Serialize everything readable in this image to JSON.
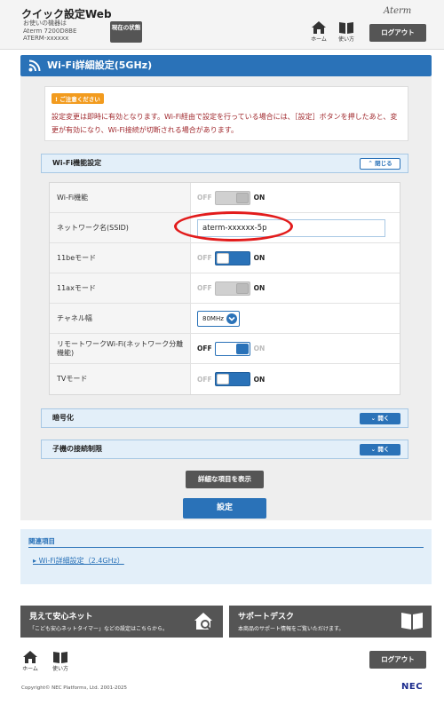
{
  "header": {
    "app_title": "クイック設定Web",
    "device_label": "お使いの機器は",
    "device_model": "Aterm 7200D8BE",
    "device_id": "ATERM-xxxxxx",
    "status_button": "現在の状態",
    "home_label": "ホーム",
    "howto_label": "使い方",
    "logout_label": "ログアウト",
    "brand_logo": "Aterm"
  },
  "page": {
    "title": "Wi-Fi詳細設定(5GHz)"
  },
  "notice": {
    "badge": "ご注意ください",
    "text": "設定変更は即時に有効となります。Wi-Fi経由で設定を行っている場合には、［設定］ボタンを押したあと、変更が有効になり、Wi-Fi接続が切断される場合があります。"
  },
  "wifi_section": {
    "title": "Wi-Fi機能設定",
    "collapse_label": "閉じる",
    "off_label": "OFF",
    "on_label": "ON",
    "rows": [
      {
        "label": "Wi-Fi機能",
        "state": "on-disabled"
      },
      {
        "label": "ネットワーク名(SSID)",
        "value": "aterm-xxxxxx-5p"
      },
      {
        "label": "11beモード",
        "state": "on"
      },
      {
        "label": "11axモード",
        "state": "on-disabled"
      },
      {
        "label": "チャネル幅",
        "value": "80MHz"
      },
      {
        "label": "リモートワークWi-Fi(ネットワーク分離機能)",
        "state": "off"
      },
      {
        "label": "TVモード",
        "state": "on"
      }
    ]
  },
  "encryption_section": {
    "title": "暗号化",
    "expand_label": "開く"
  },
  "restriction_section": {
    "title": "子機の接続制限",
    "expand_label": "開く"
  },
  "buttons": {
    "show_details": "詳細な項目を表示",
    "apply": "設定"
  },
  "related": {
    "title": "関連項目",
    "link": "Wi-Fi詳細設定（2.4GHz）"
  },
  "banners": [
    {
      "title": "見えて安心ネット",
      "subtitle": "「こども安心ネットタイマー」などの設定はこちらから。",
      "icon": "house-search-icon"
    },
    {
      "title": "サポートデスク",
      "subtitle": "本商品のサポート情報をご覧いただけます。",
      "icon": "book-icon"
    }
  ],
  "footer": {
    "home_label": "ホーム",
    "howto_label": "使い方",
    "logout_label": "ログアウト",
    "copyright": "Copyright© NEC Platforms, Ltd. 2001-2025",
    "brand": "NEC"
  },
  "colors": {
    "accent": "#2a72b8",
    "warning_text": "#a0282d",
    "badge": "#f29b1e",
    "highlight": "#e21c1c"
  }
}
